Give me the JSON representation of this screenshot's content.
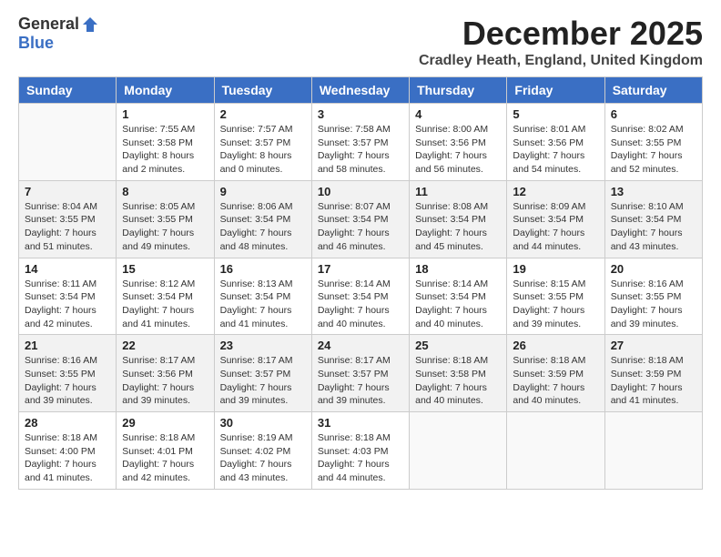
{
  "header": {
    "logo_general": "General",
    "logo_blue": "Blue",
    "title": "December 2025",
    "location": "Cradley Heath, England, United Kingdom"
  },
  "columns": [
    "Sunday",
    "Monday",
    "Tuesday",
    "Wednesday",
    "Thursday",
    "Friday",
    "Saturday"
  ],
  "weeks": [
    [
      {
        "day": "",
        "info": ""
      },
      {
        "day": "1",
        "info": "Sunrise: 7:55 AM\nSunset: 3:58 PM\nDaylight: 8 hours\nand 2 minutes."
      },
      {
        "day": "2",
        "info": "Sunrise: 7:57 AM\nSunset: 3:57 PM\nDaylight: 8 hours\nand 0 minutes."
      },
      {
        "day": "3",
        "info": "Sunrise: 7:58 AM\nSunset: 3:57 PM\nDaylight: 7 hours\nand 58 minutes."
      },
      {
        "day": "4",
        "info": "Sunrise: 8:00 AM\nSunset: 3:56 PM\nDaylight: 7 hours\nand 56 minutes."
      },
      {
        "day": "5",
        "info": "Sunrise: 8:01 AM\nSunset: 3:56 PM\nDaylight: 7 hours\nand 54 minutes."
      },
      {
        "day": "6",
        "info": "Sunrise: 8:02 AM\nSunset: 3:55 PM\nDaylight: 7 hours\nand 52 minutes."
      }
    ],
    [
      {
        "day": "7",
        "info": "Sunrise: 8:04 AM\nSunset: 3:55 PM\nDaylight: 7 hours\nand 51 minutes."
      },
      {
        "day": "8",
        "info": "Sunrise: 8:05 AM\nSunset: 3:55 PM\nDaylight: 7 hours\nand 49 minutes."
      },
      {
        "day": "9",
        "info": "Sunrise: 8:06 AM\nSunset: 3:54 PM\nDaylight: 7 hours\nand 48 minutes."
      },
      {
        "day": "10",
        "info": "Sunrise: 8:07 AM\nSunset: 3:54 PM\nDaylight: 7 hours\nand 46 minutes."
      },
      {
        "day": "11",
        "info": "Sunrise: 8:08 AM\nSunset: 3:54 PM\nDaylight: 7 hours\nand 45 minutes."
      },
      {
        "day": "12",
        "info": "Sunrise: 8:09 AM\nSunset: 3:54 PM\nDaylight: 7 hours\nand 44 minutes."
      },
      {
        "day": "13",
        "info": "Sunrise: 8:10 AM\nSunset: 3:54 PM\nDaylight: 7 hours\nand 43 minutes."
      }
    ],
    [
      {
        "day": "14",
        "info": "Sunrise: 8:11 AM\nSunset: 3:54 PM\nDaylight: 7 hours\nand 42 minutes."
      },
      {
        "day": "15",
        "info": "Sunrise: 8:12 AM\nSunset: 3:54 PM\nDaylight: 7 hours\nand 41 minutes."
      },
      {
        "day": "16",
        "info": "Sunrise: 8:13 AM\nSunset: 3:54 PM\nDaylight: 7 hours\nand 41 minutes."
      },
      {
        "day": "17",
        "info": "Sunrise: 8:14 AM\nSunset: 3:54 PM\nDaylight: 7 hours\nand 40 minutes."
      },
      {
        "day": "18",
        "info": "Sunrise: 8:14 AM\nSunset: 3:54 PM\nDaylight: 7 hours\nand 40 minutes."
      },
      {
        "day": "19",
        "info": "Sunrise: 8:15 AM\nSunset: 3:55 PM\nDaylight: 7 hours\nand 39 minutes."
      },
      {
        "day": "20",
        "info": "Sunrise: 8:16 AM\nSunset: 3:55 PM\nDaylight: 7 hours\nand 39 minutes."
      }
    ],
    [
      {
        "day": "21",
        "info": "Sunrise: 8:16 AM\nSunset: 3:55 PM\nDaylight: 7 hours\nand 39 minutes."
      },
      {
        "day": "22",
        "info": "Sunrise: 8:17 AM\nSunset: 3:56 PM\nDaylight: 7 hours\nand 39 minutes."
      },
      {
        "day": "23",
        "info": "Sunrise: 8:17 AM\nSunset: 3:57 PM\nDaylight: 7 hours\nand 39 minutes."
      },
      {
        "day": "24",
        "info": "Sunrise: 8:17 AM\nSunset: 3:57 PM\nDaylight: 7 hours\nand 39 minutes."
      },
      {
        "day": "25",
        "info": "Sunrise: 8:18 AM\nSunset: 3:58 PM\nDaylight: 7 hours\nand 40 minutes."
      },
      {
        "day": "26",
        "info": "Sunrise: 8:18 AM\nSunset: 3:59 PM\nDaylight: 7 hours\nand 40 minutes."
      },
      {
        "day": "27",
        "info": "Sunrise: 8:18 AM\nSunset: 3:59 PM\nDaylight: 7 hours\nand 41 minutes."
      }
    ],
    [
      {
        "day": "28",
        "info": "Sunrise: 8:18 AM\nSunset: 4:00 PM\nDaylight: 7 hours\nand 41 minutes."
      },
      {
        "day": "29",
        "info": "Sunrise: 8:18 AM\nSunset: 4:01 PM\nDaylight: 7 hours\nand 42 minutes."
      },
      {
        "day": "30",
        "info": "Sunrise: 8:19 AM\nSunset: 4:02 PM\nDaylight: 7 hours\nand 43 minutes."
      },
      {
        "day": "31",
        "info": "Sunrise: 8:18 AM\nSunset: 4:03 PM\nDaylight: 7 hours\nand 44 minutes."
      },
      {
        "day": "",
        "info": ""
      },
      {
        "day": "",
        "info": ""
      },
      {
        "day": "",
        "info": ""
      }
    ]
  ]
}
